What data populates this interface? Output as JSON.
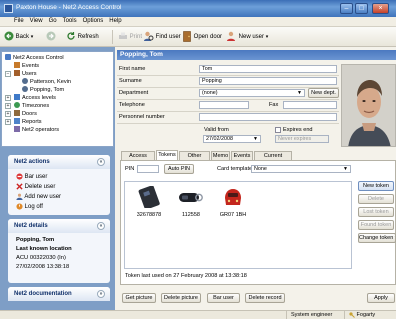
{
  "window": {
    "title": "Paxton House - Net2 Access Control",
    "min_glyph": "–",
    "max_glyph": "□",
    "close_glyph": "×"
  },
  "menu": [
    "File",
    "View",
    "Go",
    "Tools",
    "Options",
    "Help"
  ],
  "toolbar": {
    "back": "Back",
    "refresh": "Refresh",
    "print": "Print",
    "find_user": "Find user",
    "open_door": "Open door",
    "new_user": "New user"
  },
  "tree": {
    "root": "Net2 Access Control",
    "items": [
      {
        "label": "Events",
        "color": "#c77a2a"
      },
      {
        "label": "Users",
        "color": "#a35f2b"
      },
      {
        "label": "Patterson, Kevin",
        "color": "#546d8e"
      },
      {
        "label": "Popping, Tom",
        "color": "#546d8e"
      },
      {
        "label": "Access levels",
        "color": "#3f7ac8"
      },
      {
        "label": "Timezones",
        "color": "#3c9a51"
      },
      {
        "label": "Doors",
        "color": "#8f6b3d"
      },
      {
        "label": "Reports",
        "color": "#4e83c9"
      },
      {
        "label": "Net2 operators",
        "color": "#7d6ba8"
      }
    ]
  },
  "actions": {
    "title": "Net2 actions",
    "items": [
      "Bar user",
      "Delete user",
      "Add new user",
      "Log off"
    ]
  },
  "details": {
    "title": "Net2 details",
    "name": "Popping, Tom",
    "location_heading": "Last known location",
    "location": "ACU 00322030 (In)",
    "datetime": "27/02/2008 13:38:18"
  },
  "documentation": {
    "title": "Net2 documentation"
  },
  "user": {
    "header": "Popping, Tom",
    "first_name_label": "First name",
    "first_name": "Tom",
    "surname_label": "Surname",
    "surname": "Popping",
    "department_label": "Department",
    "department": "(none)",
    "new_dept": "New dept.",
    "telephone_label": "Telephone",
    "telephone": "",
    "fax_label": "Fax",
    "fax": "",
    "personnel_label": "Personnel number",
    "personnel": "",
    "valid_from_label": "Valid from",
    "valid_from": "27/02/2008",
    "expires_label": "Expires end",
    "expires_placeholder": "Never expires"
  },
  "tabs": [
    "Access rights",
    "Tokens",
    "Other details",
    "Memo",
    "Events",
    "Current validity"
  ],
  "tokens_tab": {
    "pin_label": "PIN",
    "auto_pin": "Auto PIN",
    "card_template_label": "Card template",
    "card_template": "None",
    "tokens": [
      {
        "number": "32678878",
        "type": "card"
      },
      {
        "number": "112558",
        "type": "fob"
      },
      {
        "number": "GR07 1BH",
        "type": "tag"
      }
    ],
    "buttons": [
      "New token",
      "Delete",
      "Lost token",
      "Found token",
      "Change token type"
    ],
    "footer": "Token last used on 27 February 2008 at 13:38:18"
  },
  "bottom_buttons": [
    "Get picture",
    "Delete picture",
    "Bar user",
    "Delete record"
  ],
  "apply": "Apply",
  "status": {
    "operator": "System engineer",
    "user": "Fogarty"
  }
}
